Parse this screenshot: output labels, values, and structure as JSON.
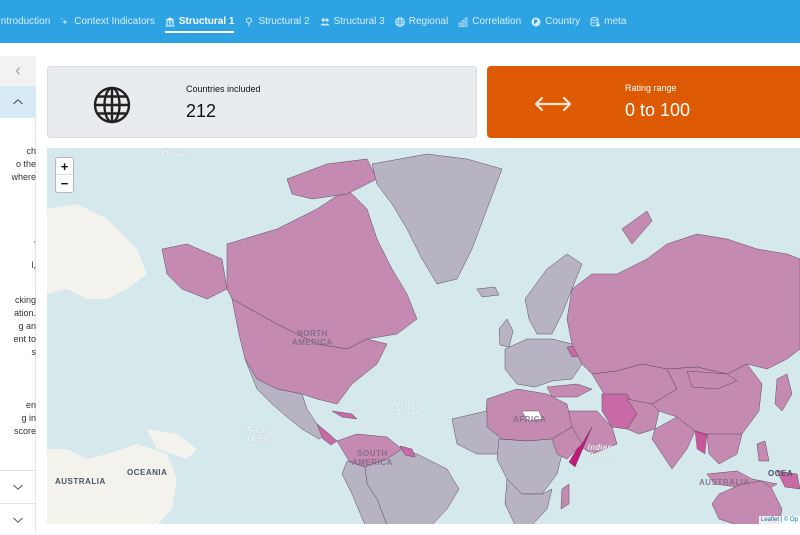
{
  "nav": {
    "tabs": [
      {
        "label": "Introduction",
        "icon": "none",
        "active": false
      },
      {
        "label": "Context Indicators",
        "icon": "sparkle-icon",
        "active": false
      },
      {
        "label": "Structural 1",
        "icon": "bank-icon",
        "active": true
      },
      {
        "label": "Structural 2",
        "icon": "pin-icon",
        "active": false
      },
      {
        "label": "Structural 3",
        "icon": "people-icon",
        "active": false
      },
      {
        "label": "Regional",
        "icon": "globe-icon",
        "active": false
      },
      {
        "label": "Correlation",
        "icon": "bar-chart-icon",
        "active": false
      },
      {
        "label": "Country",
        "icon": "globe-shield-icon",
        "active": false
      },
      {
        "label": "meta",
        "icon": "database-icon",
        "active": false
      }
    ]
  },
  "sidebar": {
    "collapse_icon": "chevron-left-icon",
    "text_fragments": {
      "block1": [
        "ch",
        "o the",
        "where"
      ],
      "block2": [
        ",",
        "",
        "l,"
      ],
      "block3": [
        "cking",
        "ation.",
        "g an",
        "ent to",
        "s"
      ],
      "block4": [
        "en",
        "g in",
        "score"
      ]
    }
  },
  "cards": {
    "countries": {
      "label": "Countries included",
      "value": "212",
      "icon": "globe-icon"
    },
    "rating": {
      "label": "Rating range",
      "value": "0 to 100",
      "icon": "left-right-arrow-icon"
    }
  },
  "map": {
    "zoom_in": "+",
    "zoom_out": "−",
    "labels": {
      "ocean_top": "Ocean",
      "north_america": [
        "NORTH",
        "AMERICA"
      ],
      "south_america": [
        "SOUTH",
        "AMERICA"
      ],
      "africa": "AFRICA",
      "atlantic": [
        "Atlantic",
        "Ocean"
      ],
      "pacific": [
        "Pacific",
        "Ocean"
      ],
      "indian": [
        "Indian",
        "Ocean"
      ],
      "oceania_left": "OCEANIA",
      "australia_left": "AUSTRALIA",
      "australia": "AUSTRALIA",
      "oceania_right": "OCEA"
    },
    "attribution": "Leaflet | © Op",
    "colors": {
      "ocean": "#d5e8ec",
      "land_base": "#f4f2ec",
      "low": "#b8b3c3",
      "mid": "#c58ab1",
      "high": "#c86aa5",
      "max": "#c2197a"
    }
  }
}
